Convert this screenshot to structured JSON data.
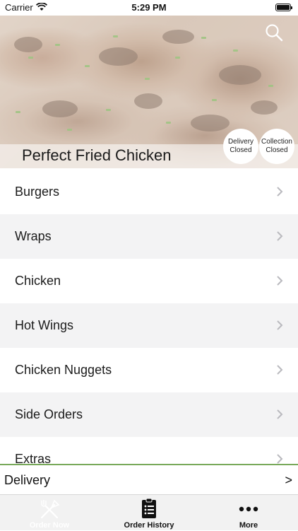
{
  "status_bar": {
    "carrier": "Carrier",
    "time": "5:29 PM"
  },
  "hero": {
    "restaurant_name": "Perfect Fried Chicken",
    "search_icon": "search-icon",
    "delivery_status": {
      "line1": "Delivery",
      "line2": "Closed"
    },
    "collection_status": {
      "line1": "Collection",
      "line2": "Closed"
    }
  },
  "menu": {
    "items": [
      {
        "label": "Burgers"
      },
      {
        "label": "Wraps"
      },
      {
        "label": "Chicken"
      },
      {
        "label": "Hot Wings"
      },
      {
        "label": "Chicken Nuggets"
      },
      {
        "label": "Side Orders"
      },
      {
        "label": "Extras"
      }
    ]
  },
  "delivery_bar": {
    "label": "Delivery",
    "arrow": ">"
  },
  "tabbar": {
    "tabs": [
      {
        "label": "Order Now",
        "icon": "fork-knife-icon"
      },
      {
        "label": "Order History",
        "icon": "clipboard-list-icon"
      },
      {
        "label": "More",
        "icon": "more-dots-icon"
      }
    ]
  },
  "colors": {
    "accent_green": "#78a95a",
    "tabbar_bg": "#f2f2f2",
    "row_alt": "#f3f3f4"
  }
}
